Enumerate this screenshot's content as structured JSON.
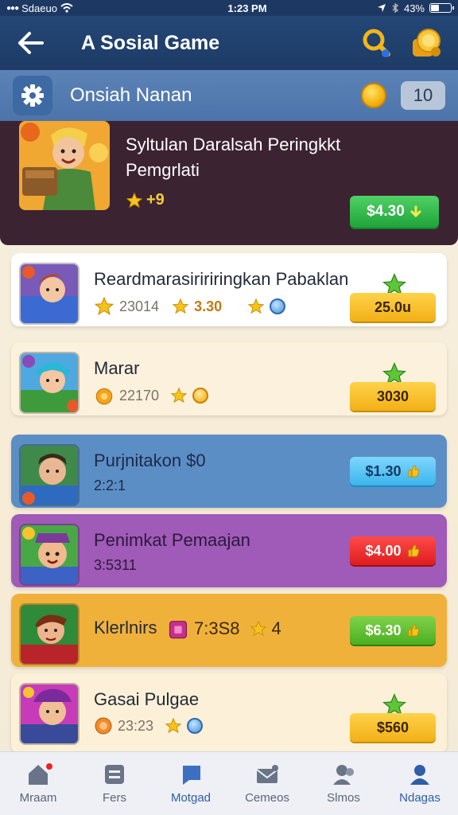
{
  "status_bar": {
    "carrier": "Sdaeuo",
    "time": "1:23 PM",
    "battery": "43%",
    "battery_level": 0.43
  },
  "header": {
    "title": "A Sosial Game"
  },
  "category": {
    "label": "Onsiah Nanan",
    "count": "10"
  },
  "featured": {
    "title": "Syltulan Daralsah Peringkkt Pemgrlati",
    "rating": "+9",
    "price": "$4.30"
  },
  "games": [
    {
      "name": "Reardmarasiririringkan Pabaklan",
      "meta1": "23014",
      "meta2": "3.30",
      "price": "25.0u",
      "style": "yellow",
      "bg": "#ffffff"
    },
    {
      "name": "Marar",
      "meta1": "22170",
      "meta2": "",
      "price": "3030",
      "style": "yellow",
      "bg": "#fcf1dc"
    },
    {
      "name": "Purjnitakon   $0",
      "meta1": "2:2:1",
      "meta2": "",
      "price": "$1.30",
      "style": "blue",
      "bg": "#5c8ec6"
    },
    {
      "name": "Penimkat Pemaajan",
      "meta1": "3:5311",
      "meta2": "",
      "price": "$4.00",
      "style": "red",
      "bg": "#a05ab8"
    },
    {
      "name": "Klerlnirs",
      "meta1": "7:3S8",
      "meta2": "4",
      "price": "$6.30",
      "style": "green",
      "bg": "#f0b13b"
    },
    {
      "name": "Gasai Pulgae",
      "meta1": "23:23",
      "meta2": "",
      "price": "$560",
      "style": "yellow",
      "bg": "#fcf1d8"
    }
  ],
  "nav": [
    {
      "label": "Mraam",
      "icon": "home-icon"
    },
    {
      "label": "Fers",
      "icon": "list-icon"
    },
    {
      "label": "Motgad",
      "icon": "chat-icon"
    },
    {
      "label": "Cemeos",
      "icon": "mail-icon"
    },
    {
      "label": "Slmos",
      "icon": "people-icon"
    },
    {
      "label": "Ndagas",
      "icon": "profile-icon"
    }
  ]
}
